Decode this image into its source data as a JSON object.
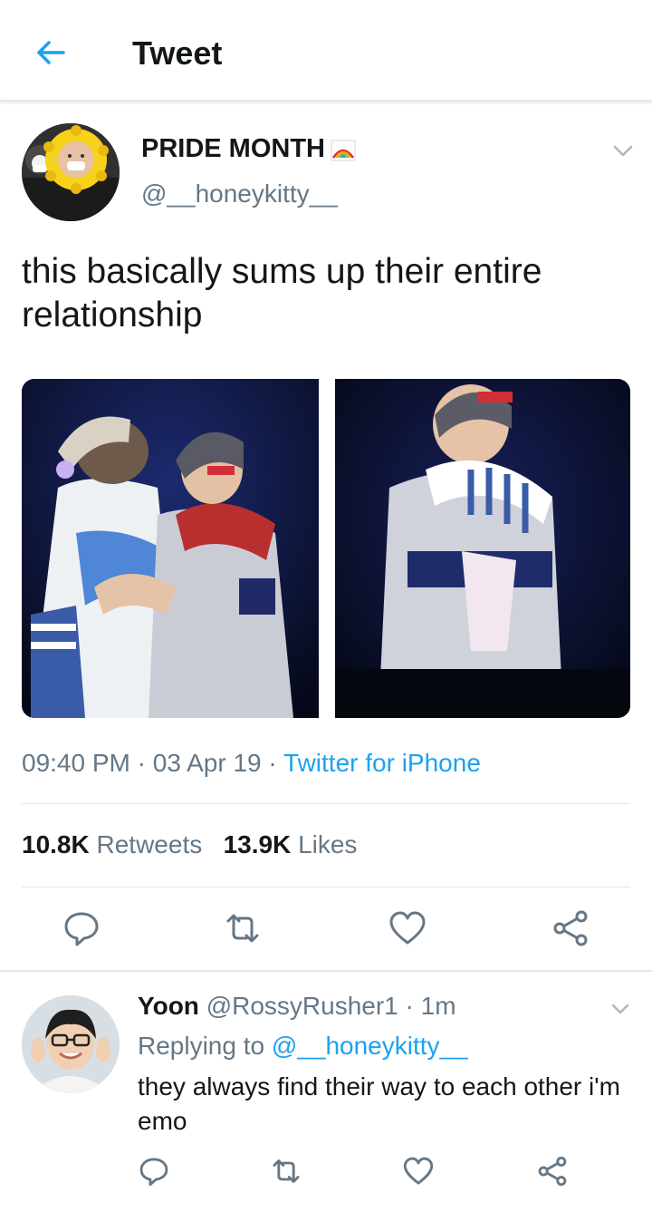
{
  "header": {
    "title": "Tweet",
    "back_icon": "arrow-left-icon"
  },
  "tweet": {
    "display_name": "PRIDE MONTH",
    "handle": "@__honeykitty__",
    "text": "this basically sums up their entire relationship",
    "time": "09:40 PM",
    "sep1": " · ",
    "date": "03 Apr 19",
    "sep2": " · ",
    "source": "Twitter for iPhone",
    "retweets_count": "10.8K",
    "retweets_label": "Retweets",
    "likes_count": "13.9K",
    "likes_label": "Likes"
  },
  "reply": {
    "name": "Yoon",
    "handle": "@RossyRusher1",
    "sep": " · ",
    "time": "1m",
    "replying_prefix": "Replying to ",
    "replying_to": "@__honeykitty__",
    "text": "they always find their way to each other i'm emo"
  },
  "colors": {
    "accent": "#1da1f2",
    "secondary_text": "#657786",
    "divider": "#e1e8ed",
    "primary_text": "#14171a"
  }
}
